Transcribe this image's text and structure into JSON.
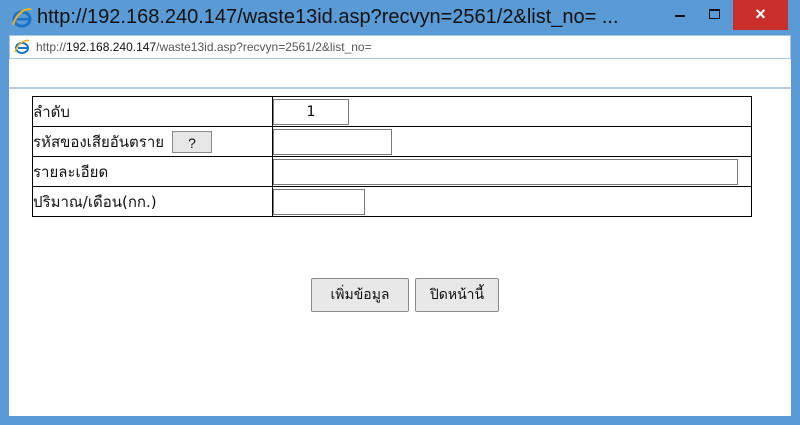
{
  "window": {
    "title": "http://192.168.240.147/waste13id.asp?recvyn=2561/2&list_no= ...",
    "close_glyph": "×",
    "icon": "ie-icon"
  },
  "address": {
    "prefix": "http://",
    "host": "192.168.240.147",
    "path": "/waste13id.asp?recvyn=2561/2&list_no="
  },
  "form": {
    "order_label": "ลำดับ",
    "order_value": "1",
    "code_label": "รหัสของเสียอันตราย",
    "help_label": "?",
    "code_value": "",
    "detail_label": "รายละเอียด",
    "detail_value": "",
    "qty_label": "ปริมาณ/เดือน(กก.)",
    "qty_value": ""
  },
  "buttons": {
    "add_label": "เพิ่มข้อมูล",
    "close_label": "ปิดหน้านี้"
  }
}
